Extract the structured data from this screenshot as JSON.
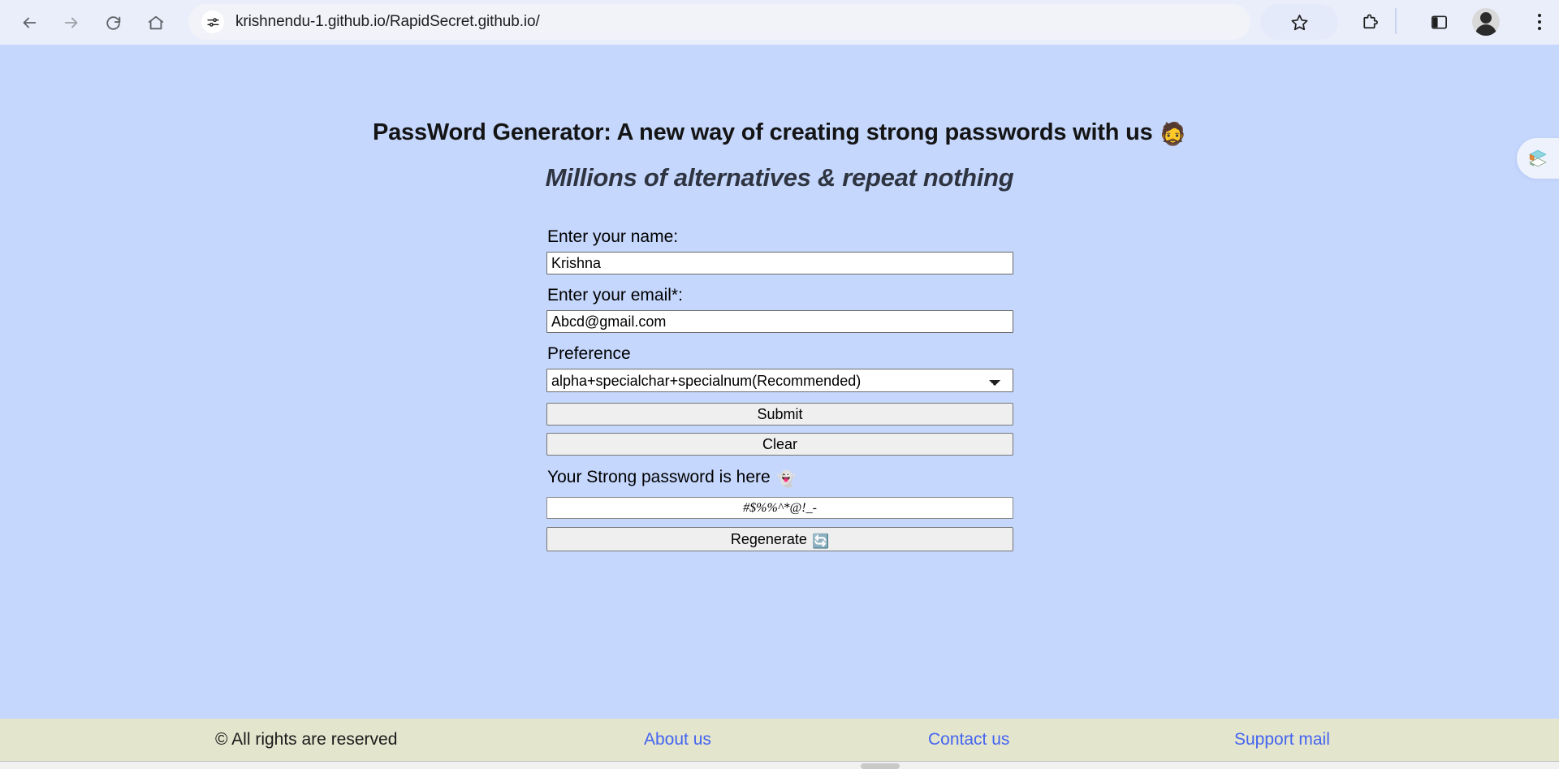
{
  "browser": {
    "url": "krishnendu-1.github.io/RapidSecret.github.io/",
    "back_label": "Back",
    "forward_label": "Forward",
    "reload_label": "Reload",
    "home_label": "Home",
    "site_info_label": "View site information",
    "bookmark_label": "Bookmark this tab",
    "extensions_label": "Extensions",
    "side_panel_label": "Side panel",
    "profile_label": "Profile",
    "menu_label": "Customize and control Google Chrome"
  },
  "page": {
    "title": "PassWord Generator: A new way of creating strong passwords with us",
    "title_emoji": "🧔",
    "subtitle": "Millions of alternatives & repeat nothing",
    "background_color": "#c5d7fd"
  },
  "form": {
    "name_label": "Enter your name:",
    "name_value": "Krishna",
    "name_placeholder": "",
    "email_label": "Enter your email*:",
    "email_value": "Abcd@gmail.com",
    "email_placeholder": "",
    "preference_label": "Preference",
    "preference_selected": "alpha+specialchar+specialnum(Recommended)",
    "preference_options": [
      "alpha+specialchar+specialnum(Recommended)"
    ],
    "submit_label": "Submit",
    "clear_label": "Clear"
  },
  "result": {
    "label": "Your Strong password is here",
    "label_emoji": "👻",
    "password": "#$%%^*@!_-",
    "regenerate_label": "Regenerate",
    "regenerate_emoji": "🔄"
  },
  "side_tab": {
    "name": "layers-stack-icon",
    "color_top": "#5bbfd0",
    "color_mid": "#e08a3c",
    "color_bottom": "#8aa98a"
  },
  "footer": {
    "copyright": "© All rights are reserved",
    "links": [
      {
        "label": "About us"
      },
      {
        "label": "Contact us"
      },
      {
        "label": "Support mail"
      }
    ],
    "background_color": "#e3e5cd",
    "link_color": "#4464f0"
  }
}
